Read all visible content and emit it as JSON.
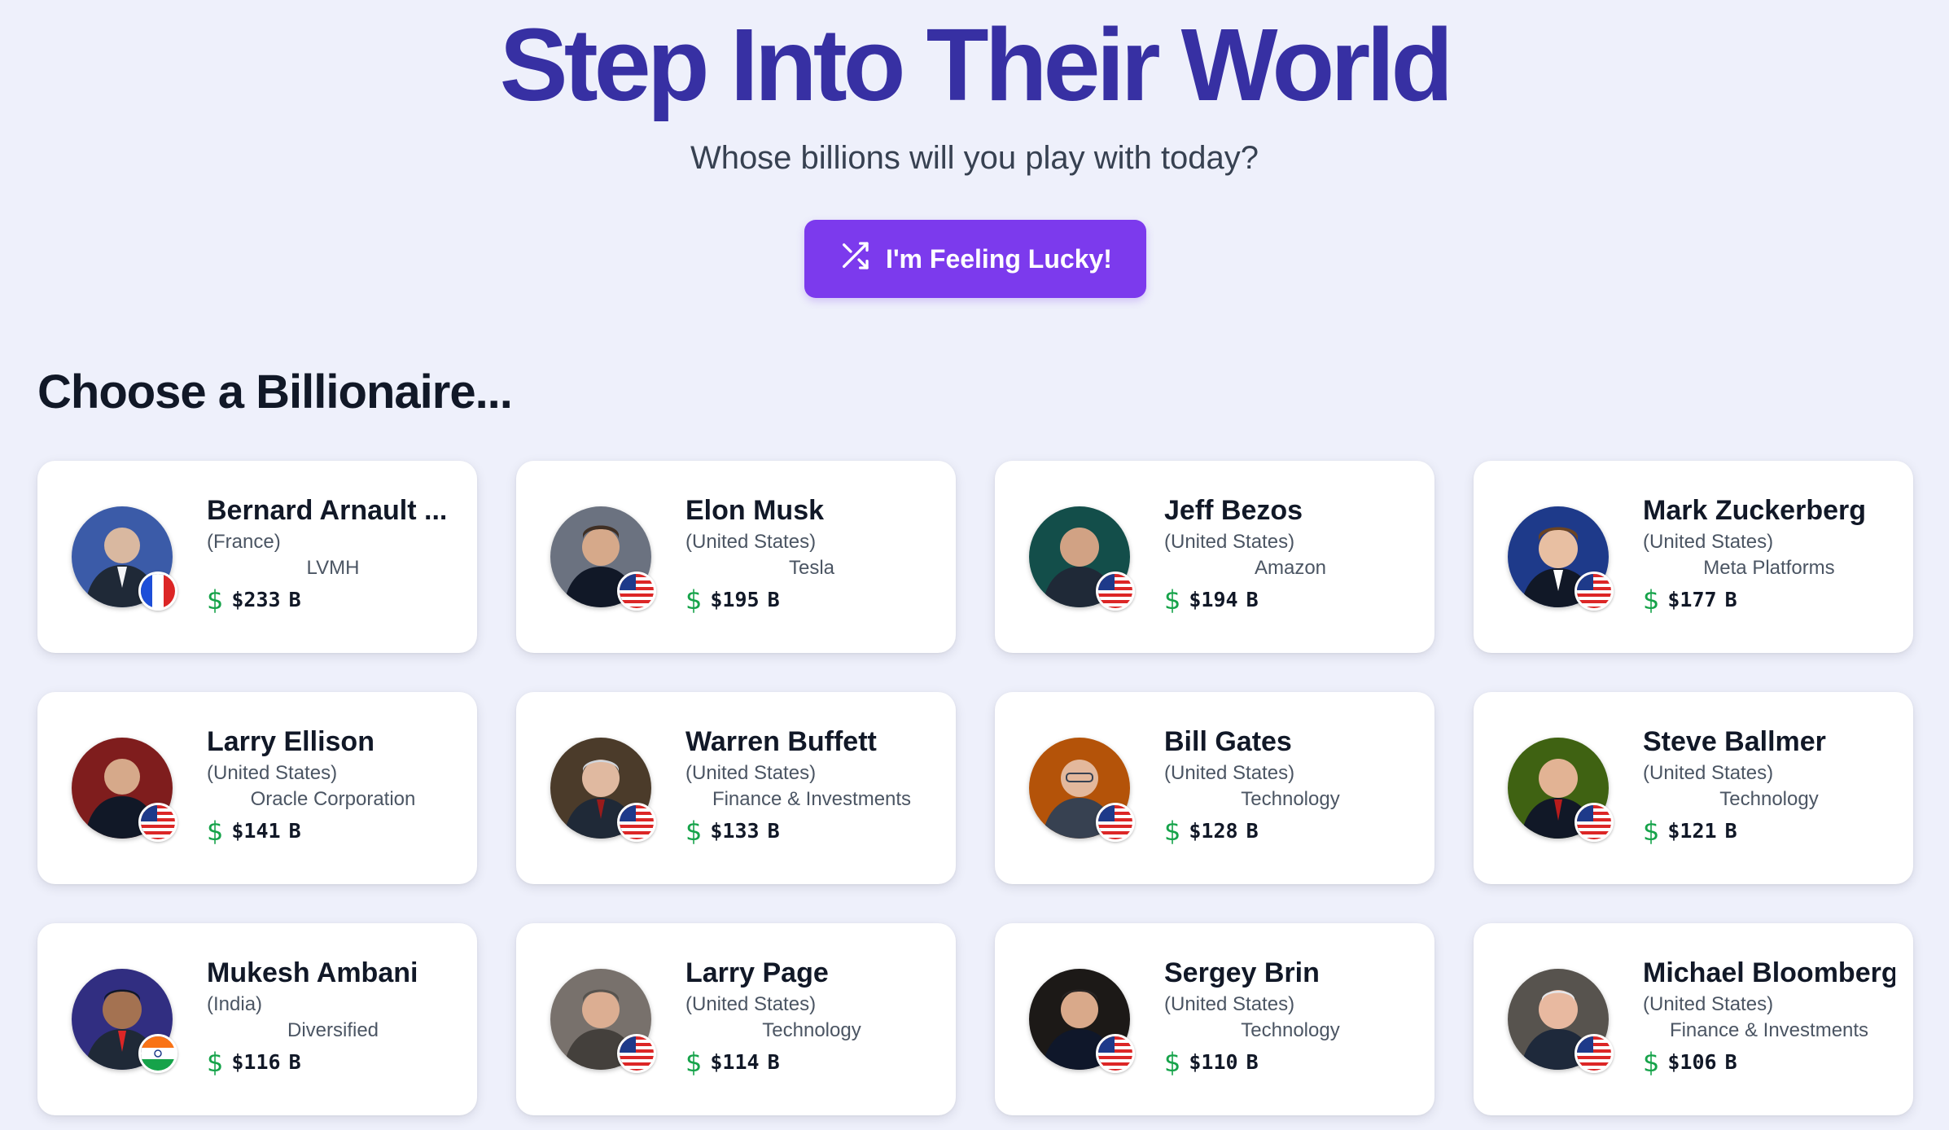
{
  "hero": {
    "title": "Step Into Their World",
    "subtitle": "Whose billions will you play with today?",
    "lucky_button": "I'm Feeling Lucky!"
  },
  "section": {
    "heading": "Choose a Billionaire..."
  },
  "colors": {
    "title": "#3730a3",
    "button": "#7c3aed",
    "dollar": "#16a34a",
    "background": "#eef0fb"
  },
  "billionaires": [
    {
      "name": "Bernard Arnault ...",
      "country": "(France)",
      "company": "LVMH",
      "worth_value": "$233",
      "worth_unit": "B",
      "flag": "france-flag-icon"
    },
    {
      "name": "Elon Musk",
      "country": "(United States)",
      "company": "Tesla",
      "worth_value": "$195",
      "worth_unit": "B",
      "flag": "usa-flag-icon"
    },
    {
      "name": "Jeff Bezos",
      "country": "(United States)",
      "company": "Amazon",
      "worth_value": "$194",
      "worth_unit": "B",
      "flag": "usa-flag-icon"
    },
    {
      "name": "Mark Zuckerberg",
      "country": "(United States)",
      "company": "Meta Platforms",
      "worth_value": "$177",
      "worth_unit": "B",
      "flag": "usa-flag-icon"
    },
    {
      "name": "Larry Ellison",
      "country": "(United States)",
      "company": "Oracle Corporation",
      "worth_value": "$141",
      "worth_unit": "B",
      "flag": "usa-flag-icon"
    },
    {
      "name": "Warren Buffett",
      "country": "(United States)",
      "company": "Finance & Investments",
      "worth_value": "$133",
      "worth_unit": "B",
      "flag": "usa-flag-icon"
    },
    {
      "name": "Bill Gates",
      "country": "(United States)",
      "company": "Technology",
      "worth_value": "$128",
      "worth_unit": "B",
      "flag": "usa-flag-icon"
    },
    {
      "name": "Steve Ballmer",
      "country": "(United States)",
      "company": "Technology",
      "worth_value": "$121",
      "worth_unit": "B",
      "flag": "usa-flag-icon"
    },
    {
      "name": "Mukesh Ambani",
      "country": "(India)",
      "company": "Diversified",
      "worth_value": "$116",
      "worth_unit": "B",
      "flag": "india-flag-icon"
    },
    {
      "name": "Larry Page",
      "country": "(United States)",
      "company": "Technology",
      "worth_value": "$114",
      "worth_unit": "B",
      "flag": "usa-flag-icon"
    },
    {
      "name": "Sergey Brin",
      "country": "(United States)",
      "company": "Technology",
      "worth_value": "$110",
      "worth_unit": "B",
      "flag": "usa-flag-icon"
    },
    {
      "name": "Michael Bloomberg",
      "country": "(United States)",
      "company": "Finance & Investments",
      "worth_value": "$106",
      "worth_unit": "B",
      "flag": "usa-flag-icon"
    }
  ]
}
